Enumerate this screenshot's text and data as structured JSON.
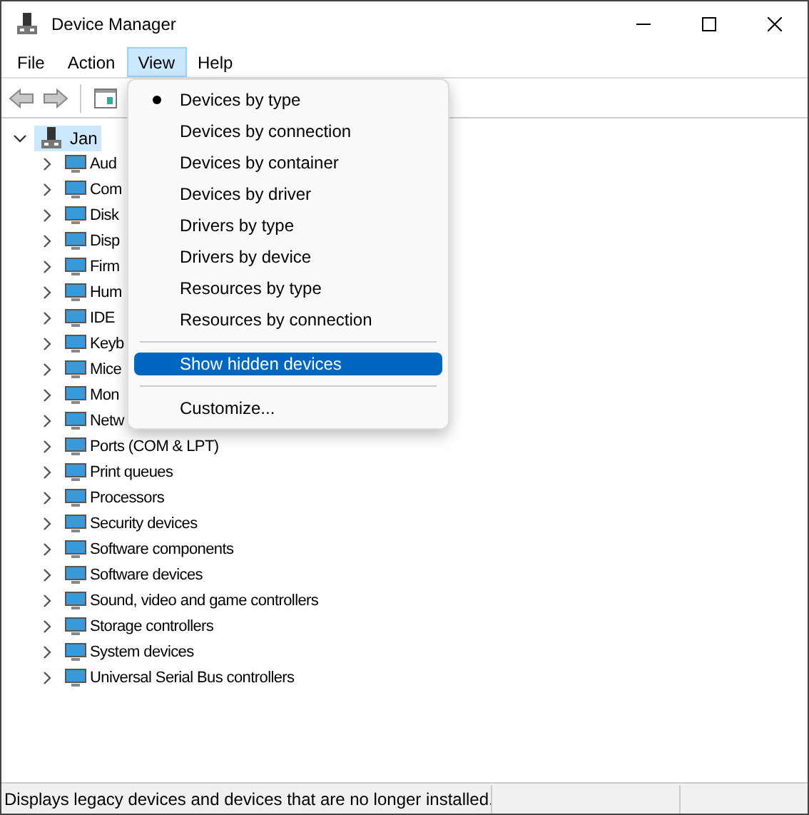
{
  "window": {
    "title": "Device Manager"
  },
  "menu_bar": [
    {
      "label": "File",
      "selected": false
    },
    {
      "label": "Action",
      "selected": false
    },
    {
      "label": "View",
      "selected": true
    },
    {
      "label": "Help",
      "selected": false
    }
  ],
  "view_menu": {
    "items": [
      {
        "kind": "option",
        "label": "Devices by type",
        "checked": true,
        "highlighted": false
      },
      {
        "kind": "option",
        "label": "Devices by connection",
        "checked": false,
        "highlighted": false
      },
      {
        "kind": "option",
        "label": "Devices by container",
        "checked": false,
        "highlighted": false
      },
      {
        "kind": "option",
        "label": "Devices by driver",
        "checked": false,
        "highlighted": false
      },
      {
        "kind": "option",
        "label": "Drivers by type",
        "checked": false,
        "highlighted": false
      },
      {
        "kind": "option",
        "label": "Drivers by device",
        "checked": false,
        "highlighted": false
      },
      {
        "kind": "option",
        "label": "Resources by type",
        "checked": false,
        "highlighted": false
      },
      {
        "kind": "option",
        "label": "Resources by connection",
        "checked": false,
        "highlighted": false
      },
      {
        "kind": "separator"
      },
      {
        "kind": "option",
        "label": "Show hidden devices",
        "checked": false,
        "highlighted": true
      },
      {
        "kind": "separator"
      },
      {
        "kind": "option",
        "label": "Customize...",
        "checked": false,
        "highlighted": false
      }
    ]
  },
  "tree": {
    "label": "Jan",
    "expanded": true,
    "selected": true,
    "children": [
      {
        "label": "Aud",
        "expanded": false
      },
      {
        "label": "Com",
        "expanded": false
      },
      {
        "label": "Disk",
        "expanded": false
      },
      {
        "label": "Disp",
        "expanded": false
      },
      {
        "label": "Firm",
        "expanded": false
      },
      {
        "label": "Hum",
        "expanded": false
      },
      {
        "label": "IDE",
        "expanded": false
      },
      {
        "label": "Keyb",
        "expanded": false
      },
      {
        "label": "Mice",
        "expanded": false
      },
      {
        "label": "Mon",
        "expanded": false
      },
      {
        "label": "Netw",
        "expanded": false
      },
      {
        "label": "Ports (COM & LPT)",
        "expanded": false
      },
      {
        "label": "Print queues",
        "expanded": false
      },
      {
        "label": "Processors",
        "expanded": false
      },
      {
        "label": "Security devices",
        "expanded": false
      },
      {
        "label": "Software components",
        "expanded": false
      },
      {
        "label": "Software devices",
        "expanded": false
      },
      {
        "label": "Sound, video and game controllers",
        "expanded": false
      },
      {
        "label": "Storage controllers",
        "expanded": false
      },
      {
        "label": "System devices",
        "expanded": false
      },
      {
        "label": "Universal Serial Bus controllers",
        "expanded": false
      }
    ]
  },
  "status_bar": {
    "text": "Displays legacy devices and devices that are no longer installed."
  }
}
